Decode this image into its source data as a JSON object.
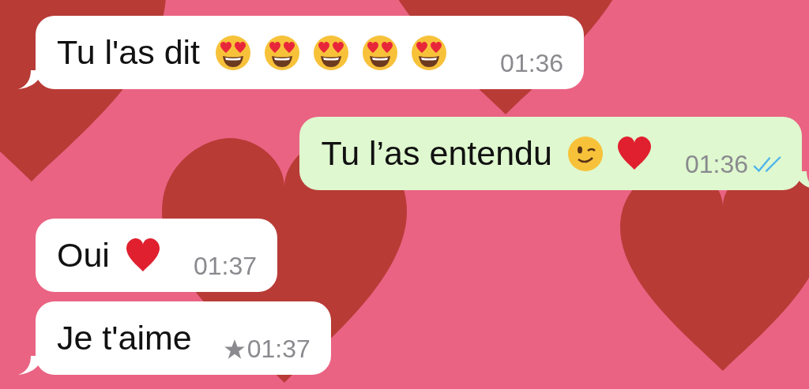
{
  "messages": [
    {
      "kind": "incoming",
      "tail": true,
      "text": "Tu l'as dit",
      "emojis": [
        {
          "kind": "heart_eyes"
        },
        {
          "kind": "heart_eyes"
        },
        {
          "kind": "heart_eyes"
        },
        {
          "kind": "heart_eyes"
        },
        {
          "kind": "heart_eyes"
        }
      ],
      "time": "01:36",
      "starred": false
    },
    {
      "kind": "outgoing",
      "tail": true,
      "text": "Tu l’as entendu",
      "emojis": [
        {
          "kind": "wink"
        },
        {
          "kind": "red_heart"
        }
      ],
      "time": "01:36",
      "starred": false,
      "read": true
    },
    {
      "kind": "incoming",
      "tail": false,
      "text": "Oui",
      "emojis": [
        {
          "kind": "red_heart"
        }
      ],
      "time": "01:37",
      "starred": false
    },
    {
      "kind": "incoming",
      "tail": true,
      "text": "Je t'aime",
      "time": "01:37",
      "starred": true
    }
  ]
}
